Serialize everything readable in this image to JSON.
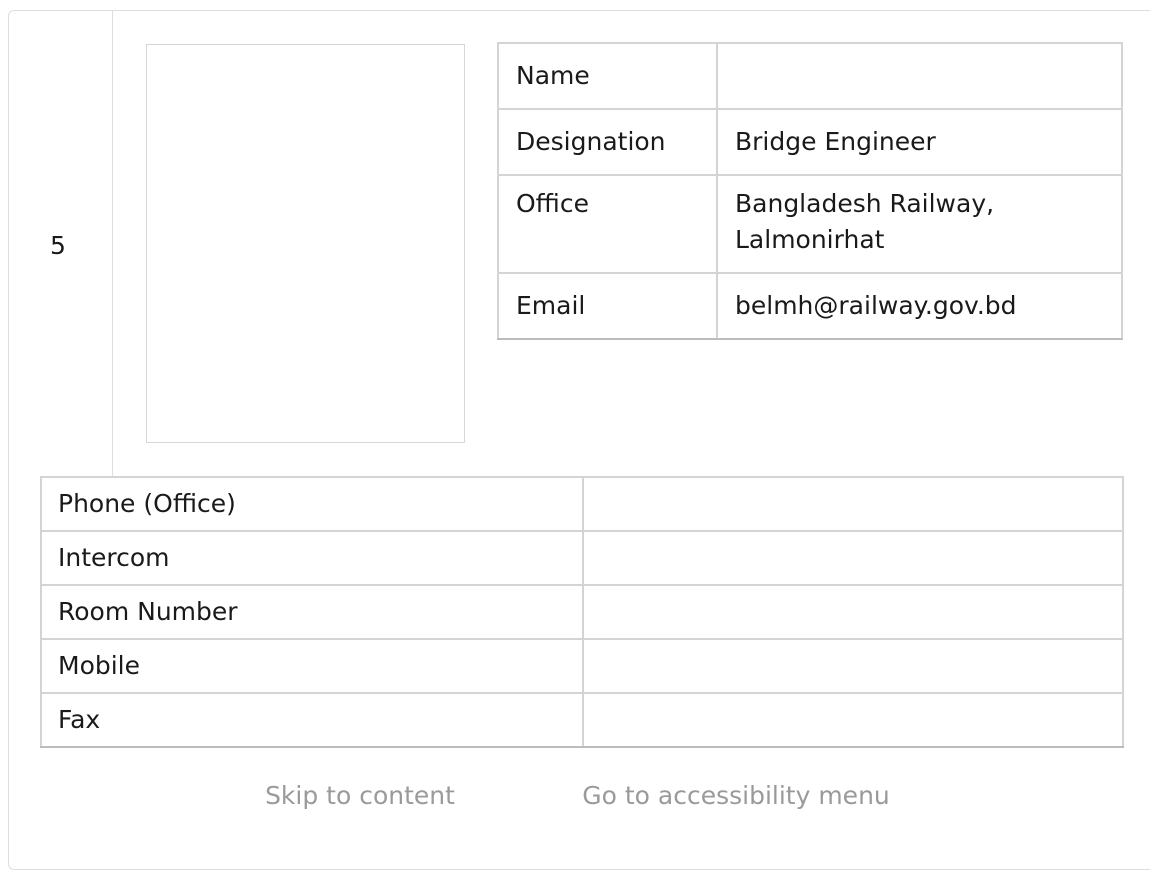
{
  "entry": {
    "index": "5",
    "info": [
      {
        "label": "Name",
        "value": ""
      },
      {
        "label": "Designation",
        "value": "Bridge Engineer"
      },
      {
        "label": "Office",
        "value": "Bangladesh Railway, Lalmonirhat"
      },
      {
        "label": "Email",
        "value": "belmh@railway.gov.bd"
      }
    ],
    "contact": [
      {
        "label": "Phone (Office)",
        "value": ""
      },
      {
        "label": "Intercom",
        "value": ""
      },
      {
        "label": "Room Number",
        "value": ""
      },
      {
        "label": "Mobile",
        "value": ""
      },
      {
        "label": "Fax",
        "value": ""
      }
    ]
  },
  "skip_links": {
    "content": "Skip to content",
    "accessibility": "Go to accessibility menu"
  }
}
